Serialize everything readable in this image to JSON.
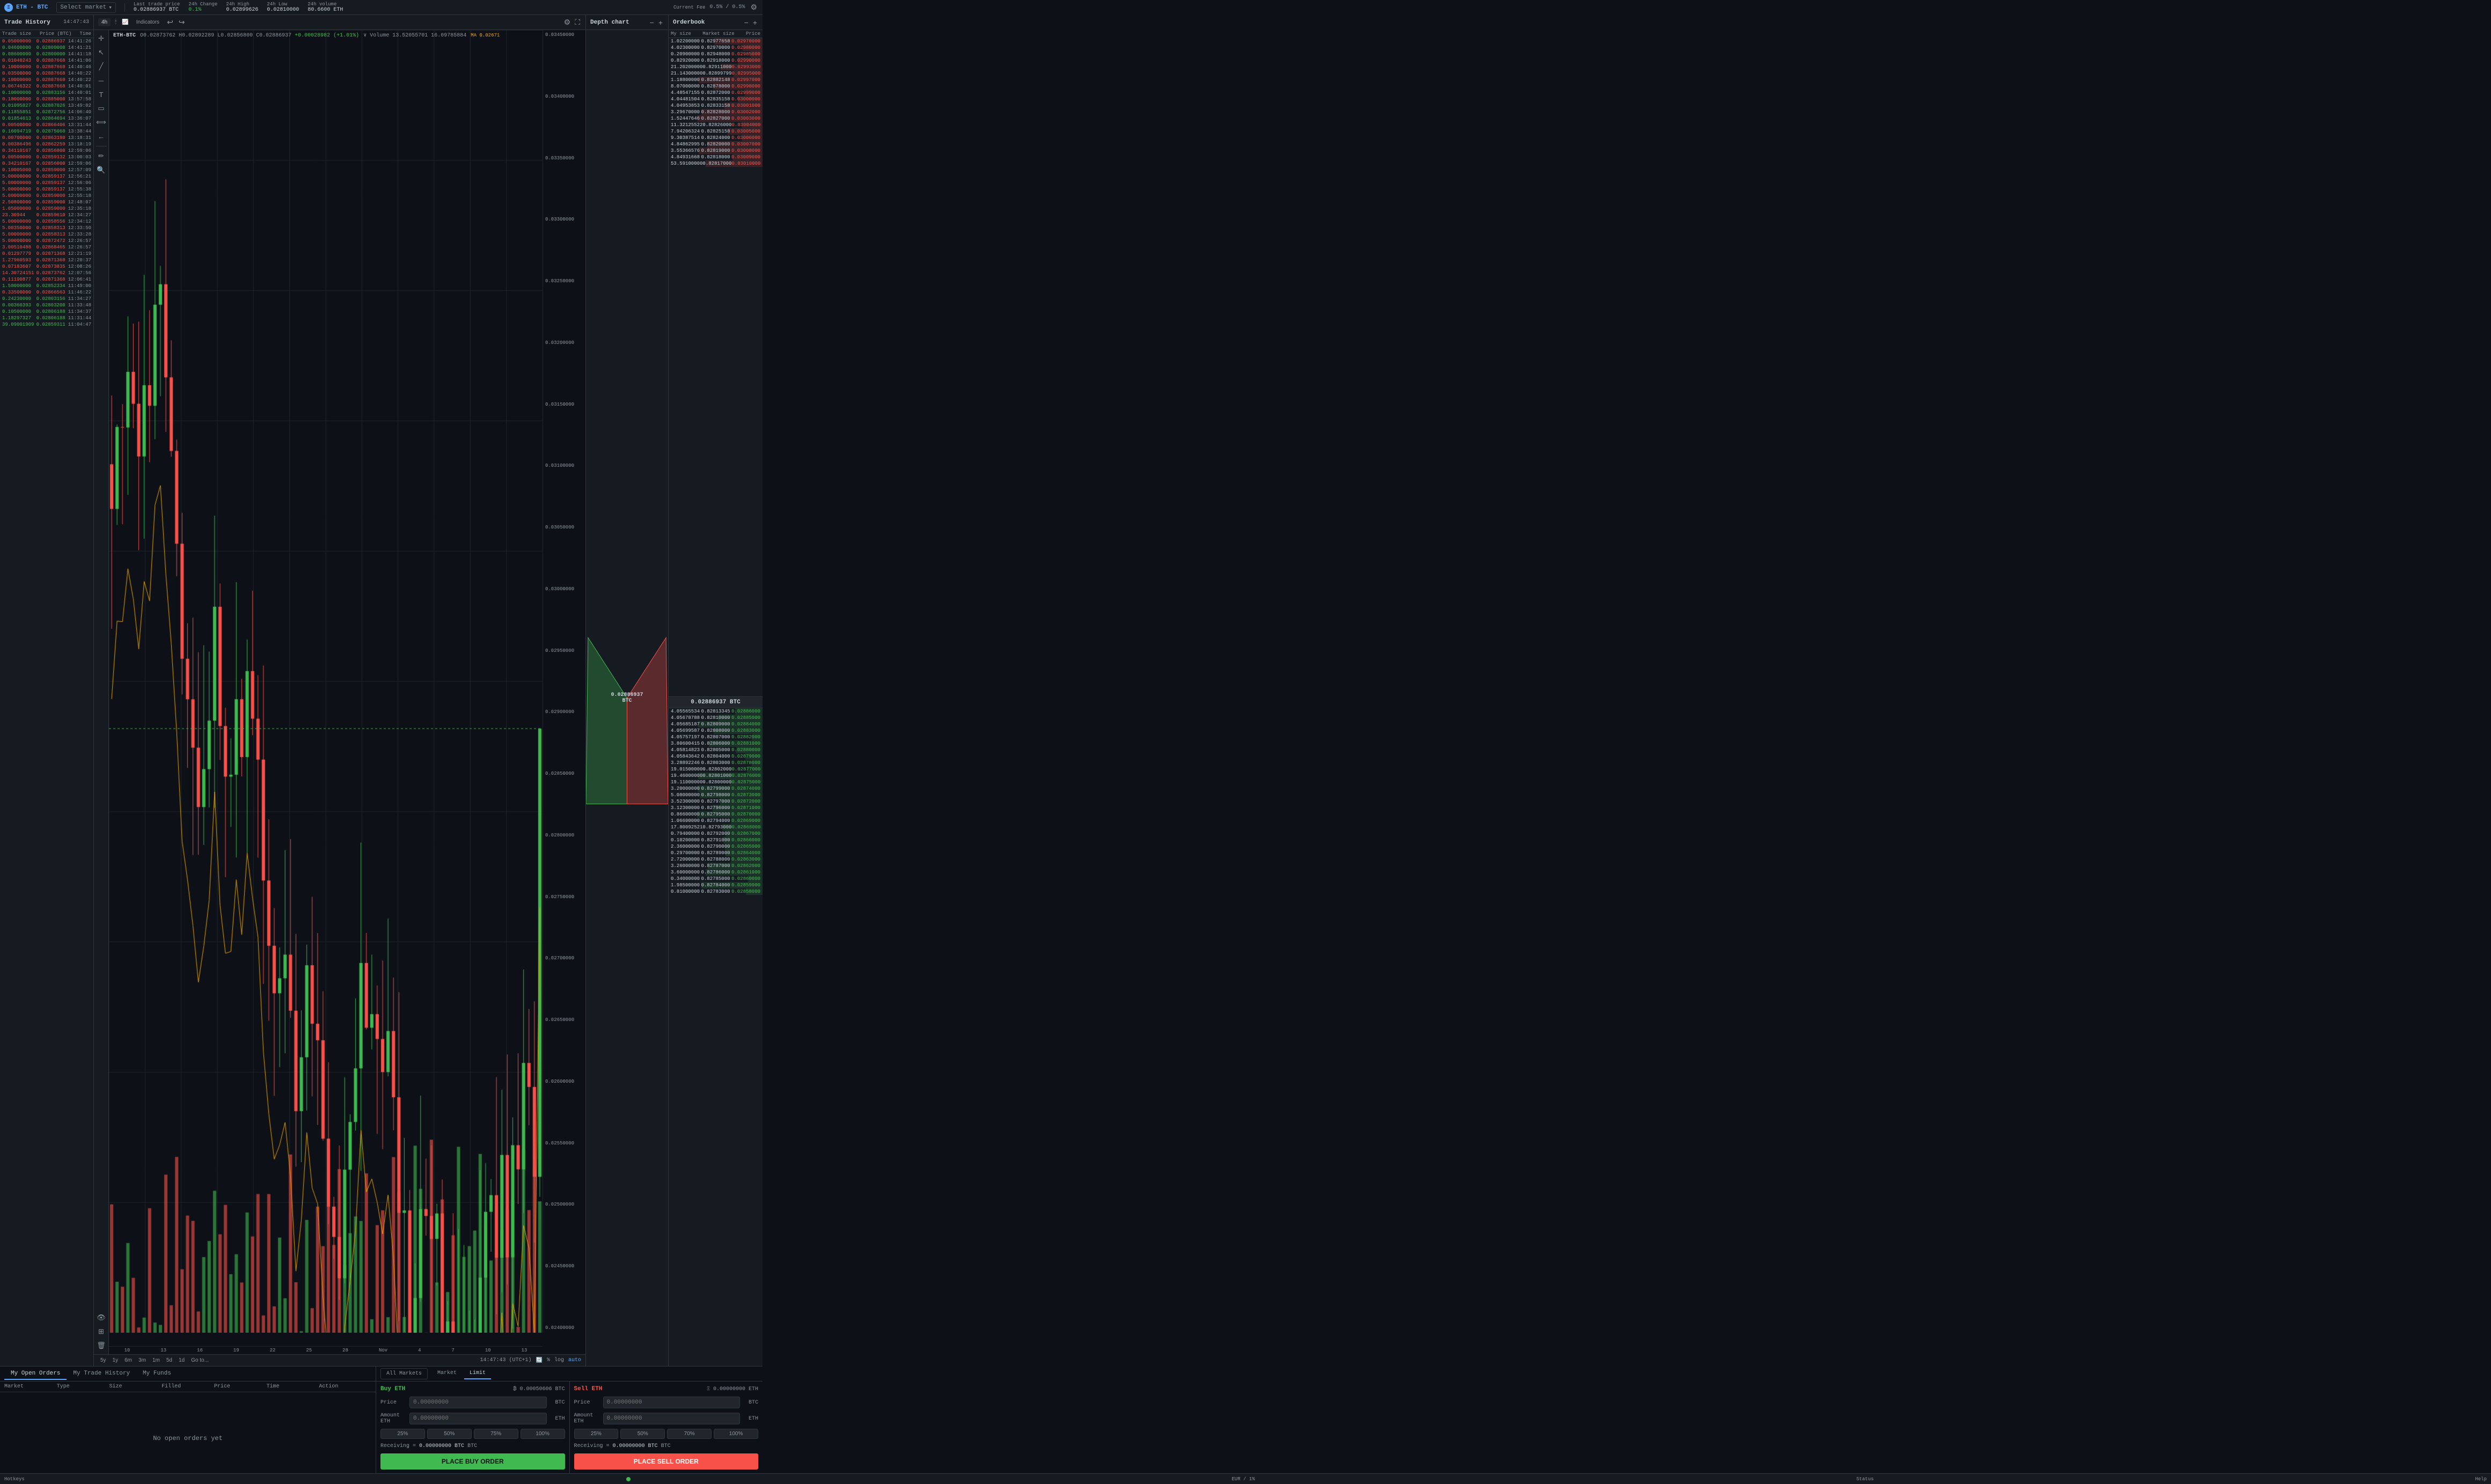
{
  "header": {
    "logo": "ETH",
    "pair": "ETH - BTC",
    "select_market": "Select market",
    "stats": {
      "last_trade_label": "Last trade price",
      "last_trade_value": "0.02886937 BTC",
      "change_24h_label": "24h Change",
      "change_24h_value": "0.1%",
      "change_24h_class": "positive",
      "high_24h_label": "24h High",
      "high_24h_value": "0.02899626",
      "low_24h_label": "24h Low",
      "low_24h_value": "0.02810000",
      "volume_24h_label": "24h volume",
      "volume_24h_value": "80.6600 ETH"
    },
    "fee_label": "Current Fee",
    "fee_value": "0.5% / 0.5%"
  },
  "chart_toolbar": {
    "timeframes": [
      "4h",
      "1y",
      "6m",
      "3m",
      "1m",
      "5d",
      "1d"
    ],
    "active_tf": "4h",
    "indicators_label": "Indicators",
    "goto_label": "Go to...",
    "time_display": "14:47:43 (UTC+1)"
  },
  "chart": {
    "symbol": "ETH-BTC",
    "open": "0.02873762",
    "high": "0.02892289",
    "low": "0.02856800",
    "close": "0.02886937",
    "change": "+0.00028982 (+1.01%)",
    "volume_label": "Volume",
    "volume_value": "13.52055701",
    "volume_unit": "16.09785884",
    "ma_label": "MA",
    "ma_value": "0.02671",
    "current_price": "0.02886937",
    "y_labels": [
      "0.03450000",
      "0.03400000",
      "0.03350000",
      "0.03300000",
      "0.03250000",
      "0.03200000",
      "0.03150000",
      "0.03100000",
      "0.03050000",
      "0.03000000",
      "0.02950000",
      "0.02900000",
      "0.02850000",
      "0.02800000",
      "0.02750000",
      "0.02700000",
      "0.02650000",
      "0.02600000",
      "0.02550000",
      "0.02500000",
      "0.02450000",
      "0.02400000"
    ],
    "x_labels": [
      "10",
      "13",
      "16",
      "19",
      "22",
      "25",
      "28",
      "Nov",
      "4",
      "7",
      "10",
      "13"
    ]
  },
  "depth_chart": {
    "title": "Depth chart",
    "current_price": "0.02886937 BTC"
  },
  "orderbook": {
    "title": "Orderbook",
    "col_my_size": "My size",
    "col_market_size": "Market size",
    "col_price": "Price",
    "asks": [
      {
        "my_size": "1.02200000",
        "market_size": "0.82977658",
        "price": "0.02970000"
      },
      {
        "my_size": "4.02300000",
        "market_size": "0.82970000",
        "price": "0.02980000"
      },
      {
        "my_size": "0.20900000",
        "market_size": "0.82948000",
        "price": "0.02985000"
      },
      {
        "my_size": "0.82920000",
        "market_size": "0.82918000",
        "price": "0.02990000"
      },
      {
        "my_size": "21.20200000",
        "market_size": "0.82911000",
        "price": "0.02993000"
      },
      {
        "my_size": "21.14300000",
        "market_size": "0.82899799",
        "price": "0.02995000"
      },
      {
        "my_size": "1.18800000",
        "market_size": "0.82882148",
        "price": "0.02997000"
      },
      {
        "my_size": "8.07000000",
        "market_size": "0.82878000",
        "price": "0.02998000"
      },
      {
        "my_size": "4.48547155",
        "market_size": "0.82872000",
        "price": "0.02999000"
      },
      {
        "my_size": "4.04481504",
        "market_size": "0.82835158",
        "price": "0.03000000"
      },
      {
        "my_size": "4.04953853",
        "market_size": "0.82833158",
        "price": "0.03001000"
      },
      {
        "my_size": "3.29670000",
        "market_size": "0.82828000",
        "price": "0.03002000"
      },
      {
        "my_size": "1.52447646",
        "market_size": "0.82827000",
        "price": "0.03003000"
      },
      {
        "my_size": "11.32125522",
        "market_size": "0.82826000",
        "price": "0.03004000"
      },
      {
        "my_size": "7.94206324",
        "market_size": "0.82825158",
        "price": "0.03005000"
      },
      {
        "my_size": "9.30387514",
        "market_size": "0.82824000",
        "price": "0.03006000"
      },
      {
        "my_size": "4.84862995",
        "market_size": "0.82820000",
        "price": "0.03007000"
      },
      {
        "my_size": "3.55366576",
        "market_size": "0.82819000",
        "price": "0.03008000"
      },
      {
        "my_size": "4.84931668",
        "market_size": "0.82818000",
        "price": "0.03009000"
      },
      {
        "my_size": "53.59100000",
        "market_size": "0.82817000",
        "price": "0.03010000"
      }
    ],
    "bids": [
      {
        "my_size": "4.05565534",
        "market_size": "0.82813345",
        "price": "0.02886000"
      },
      {
        "my_size": "4.05678788",
        "market_size": "0.82810000",
        "price": "0.02885000"
      },
      {
        "my_size": "4.05685187",
        "market_size": "0.82809000",
        "price": "0.02884000"
      },
      {
        "my_size": "4.05699587",
        "market_size": "0.82808000",
        "price": "0.02883000"
      },
      {
        "my_size": "4.05757197",
        "market_size": "0.82807000",
        "price": "0.02882000"
      },
      {
        "my_size": "3.80600415",
        "market_size": "0.82806000",
        "price": "0.02881000"
      },
      {
        "my_size": "4.05814823",
        "market_size": "0.82805000",
        "price": "0.02880000"
      },
      {
        "my_size": "4.05843642",
        "market_size": "0.82804000",
        "price": "0.02879000"
      },
      {
        "my_size": "3.28892246",
        "market_size": "0.82803000",
        "price": "0.02878000"
      },
      {
        "my_size": "19.01500000",
        "market_size": "0.82802000",
        "price": "0.02877000"
      },
      {
        "my_size": "19.46000000",
        "market_size": "0.82801000",
        "price": "0.02876000"
      },
      {
        "my_size": "19.11000000",
        "market_size": "0.82800000",
        "price": "0.02875000"
      },
      {
        "my_size": "3.20000000",
        "market_size": "0.82799000",
        "price": "0.02874000"
      },
      {
        "my_size": "5.08000000",
        "market_size": "0.82798000",
        "price": "0.02873000"
      },
      {
        "my_size": "3.52300000",
        "market_size": "0.82797000",
        "price": "0.02872000"
      },
      {
        "my_size": "3.12300000",
        "market_size": "0.82796000",
        "price": "0.02871000"
      },
      {
        "my_size": "0.86600000",
        "market_size": "0.82795000",
        "price": "0.02870000"
      },
      {
        "my_size": "1.06600000",
        "market_size": "0.82794000",
        "price": "0.02869000"
      },
      {
        "my_size": "17.80092521",
        "market_size": "0.82793000",
        "price": "0.02868000"
      },
      {
        "my_size": "0.79400000",
        "market_size": "0.82792000",
        "price": "0.02867000"
      },
      {
        "my_size": "0.10200000",
        "market_size": "0.82791000",
        "price": "0.02866000"
      },
      {
        "my_size": "2.36000000",
        "market_size": "0.82790000",
        "price": "0.02865000"
      },
      {
        "my_size": "0.29700000",
        "market_size": "0.82789000",
        "price": "0.02864000"
      },
      {
        "my_size": "2.72000000",
        "market_size": "0.82788000",
        "price": "0.02863000"
      },
      {
        "my_size": "3.26000000",
        "market_size": "0.82787000",
        "price": "0.02862000"
      },
      {
        "my_size": "3.60000000",
        "market_size": "0.82786000",
        "price": "0.02861000"
      },
      {
        "my_size": "0.34000000",
        "market_size": "0.82785000",
        "price": "0.02860000"
      },
      {
        "my_size": "1.98500000",
        "market_size": "0.82784000",
        "price": "0.02859000"
      },
      {
        "my_size": "0.81000000",
        "market_size": "0.82783000",
        "price": "0.02858000"
      }
    ],
    "mid_price": "0.02886937 BTC"
  },
  "trade_history": {
    "title": "Trade History",
    "time": "14:47:43",
    "cols": {
      "size": "Trade size",
      "price": "Price (BTC)",
      "time": "Time"
    },
    "rows": [
      {
        "size": "0.05000000",
        "price": "0.02886937",
        "time": "14:41:26",
        "side": "sell"
      },
      {
        "size": "0.04600000",
        "price": "0.02800000",
        "time": "14:41:21",
        "side": "buy"
      },
      {
        "size": "0.08600000",
        "price": "0.02800000",
        "time": "14:41:18",
        "side": "buy"
      },
      {
        "size": "0.01040243",
        "price": "0.02887668",
        "time": "14:41:06",
        "side": "sell"
      },
      {
        "size": "0.10000000",
        "price": "0.02887668",
        "time": "14:40:46",
        "side": "sell"
      },
      {
        "size": "0.03500000",
        "price": "0.02887668",
        "time": "14:40:22",
        "side": "sell"
      },
      {
        "size": "0.10000000",
        "price": "0.02887668",
        "time": "14:40:22",
        "side": "sell"
      },
      {
        "size": "0.06746322",
        "price": "0.02887668",
        "time": "14:40:01",
        "side": "sell"
      },
      {
        "size": "0.10000000",
        "price": "0.02883156",
        "time": "14:40:01",
        "side": "buy"
      },
      {
        "size": "0.18000000",
        "price": "0.02885000",
        "time": "13:57:58",
        "side": "sell"
      },
      {
        "size": "0.01095827",
        "price": "0.02887026",
        "time": "13:49:02",
        "side": "buy"
      },
      {
        "size": "0.11855851",
        "price": "0.02872756",
        "time": "14:06:40",
        "side": "buy"
      },
      {
        "size": "0.01854613",
        "price": "0.02864694",
        "time": "13:36:07",
        "side": "buy"
      },
      {
        "size": "0.00500000",
        "price": "0.02866406",
        "time": "13:31:44",
        "side": "sell"
      },
      {
        "size": "0.16094719",
        "price": "0.02875068",
        "time": "13:38:44",
        "side": "buy"
      },
      {
        "size": "0.00700000",
        "price": "0.02863180",
        "time": "13:18:31",
        "side": "sell"
      },
      {
        "size": "0.00386496",
        "price": "0.02862259",
        "time": "13:18:19",
        "side": "sell"
      },
      {
        "size": "0.34110167",
        "price": "0.02856800",
        "time": "12:59:06",
        "side": "sell"
      },
      {
        "size": "0.00500000",
        "price": "0.02859132",
        "time": "13:00:03",
        "side": "sell"
      },
      {
        "size": "0.34210167",
        "price": "0.02856000",
        "time": "12:59:06",
        "side": "sell"
      },
      {
        "size": "0.10005000",
        "price": "0.02859000",
        "time": "12:57:09",
        "side": "sell"
      },
      {
        "size": "5.00000000",
        "price": "0.02859137",
        "time": "12:56:21",
        "side": "sell"
      },
      {
        "size": "5.00000000",
        "price": "0.02859137",
        "time": "12:56:06",
        "side": "sell"
      },
      {
        "size": "5.00000000",
        "price": "0.02859137",
        "time": "12:55:38",
        "side": "sell"
      },
      {
        "size": "5.00000000",
        "price": "0.02859000",
        "time": "12:55:18",
        "side": "sell"
      },
      {
        "size": "2.50800000",
        "price": "0.02859000",
        "time": "12:48:07",
        "side": "sell"
      },
      {
        "size": "1.05000000",
        "price": "0.02859000",
        "time": "12:35:18",
        "side": "sell"
      },
      {
        "size": "23.30944",
        "price": "0.02859610",
        "time": "12:34:27",
        "side": "sell"
      },
      {
        "size": "5.00000000",
        "price": "0.02858556",
        "time": "12:34:12",
        "side": "sell"
      },
      {
        "size": "5.00350000",
        "price": "0.02858313",
        "time": "12:33:50",
        "side": "sell"
      },
      {
        "size": "5.00000000",
        "price": "0.02858313",
        "time": "12:33:28",
        "side": "sell"
      },
      {
        "size": "5.00000000",
        "price": "0.02872472",
        "time": "12:26:57",
        "side": "sell"
      },
      {
        "size": "3.00510488",
        "price": "0.02868465",
        "time": "12:26:57",
        "side": "sell"
      },
      {
        "size": "0.01297779",
        "price": "0.02871368",
        "time": "12:21:19",
        "side": "sell"
      },
      {
        "size": "1.27960593",
        "price": "0.02871368",
        "time": "12:20:37",
        "side": "sell"
      },
      {
        "size": "0.07183607",
        "price": "0.02873835",
        "time": "12:08:26",
        "side": "sell"
      },
      {
        "size": "14.30724151",
        "price": "0.02873762",
        "time": "12:07:56",
        "side": "sell"
      },
      {
        "size": "0.11190877",
        "price": "0.02871368",
        "time": "12:06:41",
        "side": "sell"
      },
      {
        "size": "1.58000000",
        "price": "0.02852334",
        "time": "11:49:00",
        "side": "buy"
      },
      {
        "size": "0.33500000",
        "price": "0.02866563",
        "time": "11:46:22",
        "side": "sell"
      },
      {
        "size": "0.24230000",
        "price": "0.02803156",
        "time": "11:34:27",
        "side": "buy"
      },
      {
        "size": "0.00360393",
        "price": "0.02803200",
        "time": "11:33:48",
        "side": "buy"
      },
      {
        "size": "0.10500000",
        "price": "0.02806188",
        "time": "11:34:37",
        "side": "buy"
      },
      {
        "size": "1.18297327",
        "price": "0.02806188",
        "time": "11:31:44",
        "side": "buy"
      },
      {
        "size": "39.09001909",
        "price": "0.02859311",
        "time": "11:04:47",
        "side": "buy"
      }
    ]
  },
  "orders_panel": {
    "tab_open": "My Open Orders",
    "tab_history": "My Trade History",
    "tab_funds": "My Funds",
    "tab_active": "open",
    "cols": [
      "Market",
      "Type",
      "Size",
      "Filled",
      "Price",
      "Time",
      "Action"
    ],
    "empty_message": "No open orders yet",
    "market_tab_all": "All Markets",
    "market_tab_market": "Market",
    "market_tab_limit": "Limit",
    "market_active": "Market",
    "limit_active": "Limit"
  },
  "trade_form": {
    "buy_label": "Buy ETH",
    "sell_label": "Sell ETH",
    "buy_balance": "0.00050606 BTC",
    "sell_balance": "0.00000000 ETH",
    "price_label": "Price",
    "price_unit": "BTC",
    "amount_label": "Amount ETH",
    "amount_unit": "ETH",
    "pct_options": [
      "25%",
      "50%",
      "75%",
      "100%"
    ],
    "receiving_label": "Receiving =",
    "buy_receiving": "0.00000000 BTC",
    "sell_receiving": "0.00000000 BTC",
    "place_buy_label": "PLACE BUY ORDER",
    "place_sell_label": "PLACE SELL ORDER"
  },
  "status_bar": {
    "hotkeys": "Hotkeys",
    "eur_unit": "EUR / 1%",
    "status": "Status",
    "help": "Help"
  }
}
